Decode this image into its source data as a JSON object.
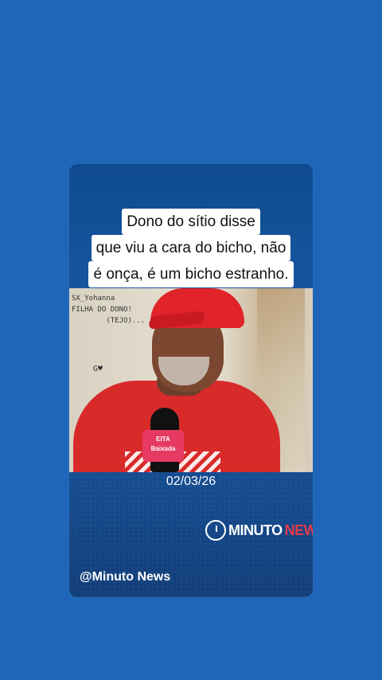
{
  "caption": {
    "lines": [
      "Dono do sítio disse",
      "que viu a cara do bicho, não",
      "é onça, é um bicho estranho."
    ]
  },
  "photo": {
    "graffiti": "SX_Yohanna\nFILHA DO DONO!\n        (TEJO)...",
    "mark": "G♥",
    "mic_label": "EITA\nBaixada"
  },
  "date": "02/03/26",
  "logo": {
    "minuto": "MINUTO",
    "news": "NEWS",
    "icon": "stopwatch-icon"
  },
  "handle": "@Minuto News",
  "colors": {
    "background": "#1f66b8",
    "card": "#1a5aa6",
    "accent_red": "#e63b49"
  }
}
